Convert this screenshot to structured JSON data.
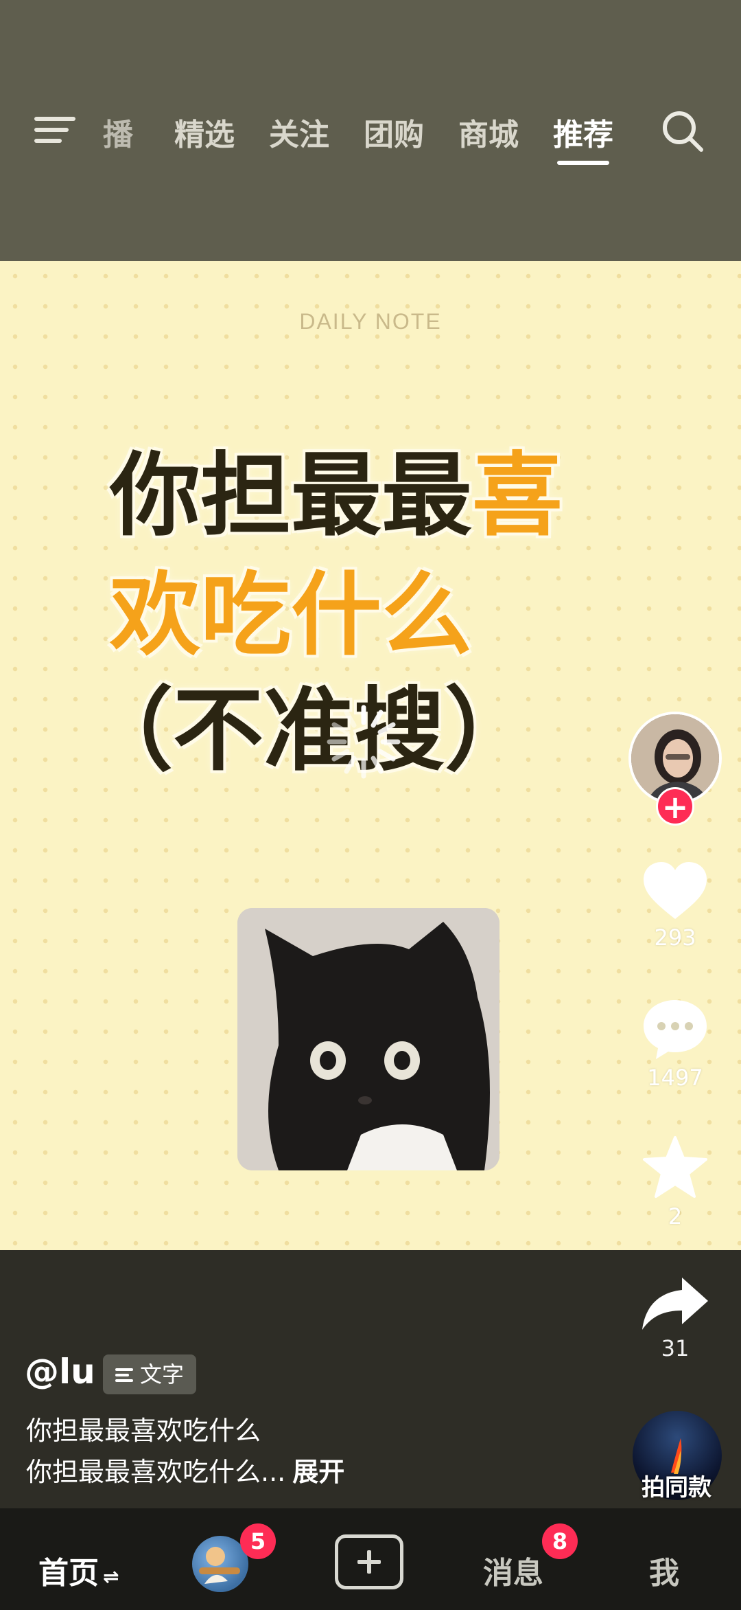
{
  "header": {
    "tabs": [
      {
        "label": "播",
        "active": false
      },
      {
        "label": "精选",
        "active": false
      },
      {
        "label": "关注",
        "active": false
      },
      {
        "label": "团购",
        "active": false
      },
      {
        "label": "商城",
        "active": false
      },
      {
        "label": "推荐",
        "active": true
      }
    ],
    "menu_icon": "menu-icon",
    "search_icon": "search-icon"
  },
  "video": {
    "daily_note": "DAILY NOTE",
    "headline": {
      "line1_dark": "你担最最",
      "line1_orange": "喜",
      "line2_orange": "欢吃什么",
      "line3_dark": "（不准搜）"
    },
    "colors": {
      "background": "#fbf3c4",
      "orange": "#f5a21a",
      "dark": "#2b2512"
    }
  },
  "actions": {
    "follow_icon": "plus-icon",
    "likes": "293",
    "comments": "1497",
    "favorites": "2",
    "shares": "31"
  },
  "caption": {
    "username": "@lu",
    "tag": "文字",
    "line1": "你担最最喜欢吃什么",
    "line2": "你担最最喜欢吃什么...",
    "expand": "展开",
    "same_style": "拍同款"
  },
  "bottom_nav": {
    "home": "首页",
    "friends_badge": "5",
    "messages": "消息",
    "messages_badge": "8",
    "me": "我"
  }
}
